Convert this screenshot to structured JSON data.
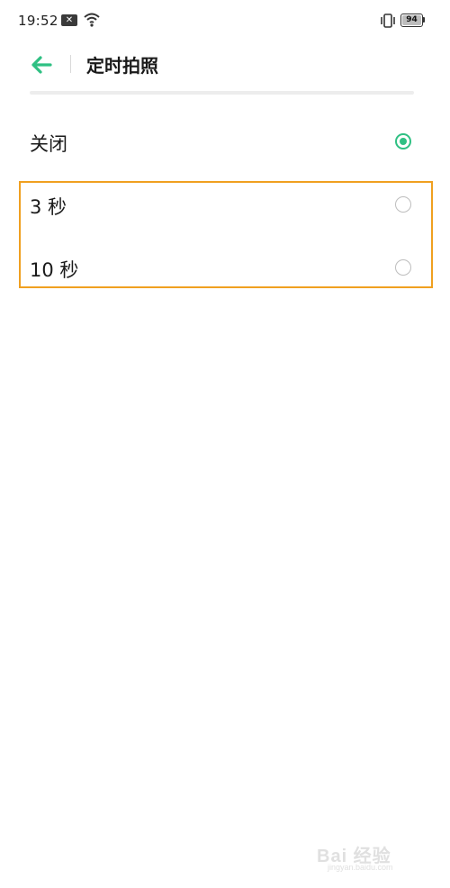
{
  "status_bar": {
    "time": "19:52",
    "notification_icon": "close-notification-icon",
    "wifi_icon": "wifi-icon",
    "vibrate_icon": "vibrate-icon",
    "battery_level": "94"
  },
  "header": {
    "back_icon": "back-arrow-icon",
    "title": "定时拍照"
  },
  "options": [
    {
      "label": "关闭",
      "selected": true
    },
    {
      "label": "3 秒",
      "selected": false
    },
    {
      "label": "10 秒",
      "selected": false
    }
  ],
  "watermark": {
    "brand": "Bai 经验",
    "url": "jingyan.baidu.com"
  },
  "colors": {
    "accent": "#2fc083",
    "highlight_border": "#f0a020",
    "radio_off": "#bdbdbd"
  }
}
